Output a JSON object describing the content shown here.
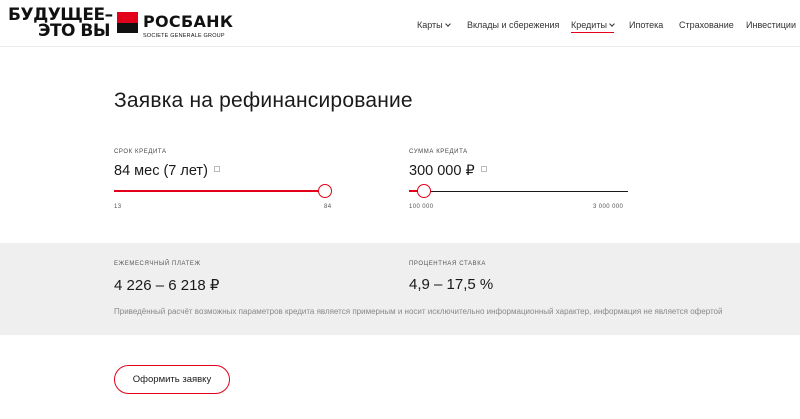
{
  "header": {
    "slogan_line1": "БУДУЩЕЕ–",
    "slogan_line2": "ЭТО ВЫ",
    "brand_name": "РОСБАНК",
    "brand_sub": "SOCIETE GENERALE GROUP",
    "nav": [
      {
        "label": "Карты",
        "dropdown": true
      },
      {
        "label": "Вклады и сбережения",
        "dropdown": false
      },
      {
        "label": "Кредиты",
        "dropdown": true,
        "active": true
      },
      {
        "label": "Ипотека",
        "dropdown": false
      },
      {
        "label": "Страхование",
        "dropdown": false
      },
      {
        "label": "Инвестиции",
        "dropdown": false
      }
    ]
  },
  "page": {
    "title": "Заявка на рефинансирование"
  },
  "term": {
    "label": "Срок кредита",
    "value": "84 мес (7 лет)",
    "min_label": "13",
    "max_label": "84",
    "fill_fraction": 1.0
  },
  "amount": {
    "label": "Сумма кредита",
    "value": "300 000 ₽",
    "min_label": "100 000",
    "max_label": "3 000 000",
    "fill_fraction": 0.07
  },
  "results": {
    "payment_label": "Ежемесячный платеж",
    "payment_value": "4 226 – 6 218 ₽",
    "rate_label": "Процентная ставка",
    "rate_value": "4,9 – 17,5 %",
    "disclaimer": "Приведённый расчёт возможных параметров кредита является примерным и носит исключительно информационный характер, информация не является офертой"
  },
  "cta": {
    "label": "Оформить заявку"
  },
  "colors": {
    "accent": "#e2001a",
    "band": "#efefef"
  },
  "icons": {
    "edit": "pencil-edit-icon",
    "chevron": "chevron-down-icon"
  }
}
